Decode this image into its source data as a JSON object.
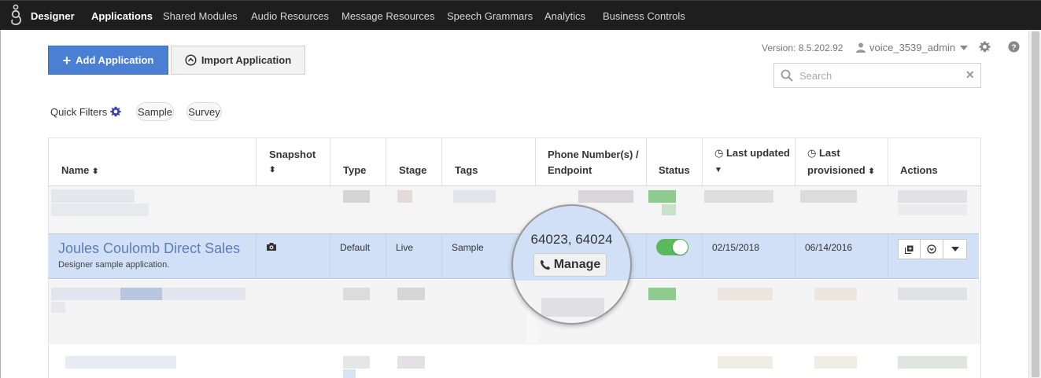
{
  "nav": {
    "brand": "Designer",
    "items": [
      {
        "label": "Applications",
        "active": true
      },
      {
        "label": "Shared Modules"
      },
      {
        "label": "Audio Resources"
      },
      {
        "label": "Message Resources"
      },
      {
        "label": "Speech Grammars"
      },
      {
        "label": "Analytics"
      },
      {
        "label": "Business Controls"
      }
    ]
  },
  "header": {
    "version": "Version: 8.5.202.92",
    "user": "voice_3539_admin",
    "search_placeholder": "Search"
  },
  "toolbar": {
    "add_label": "Add Application",
    "import_label": "Import Application"
  },
  "quick_filters": {
    "label": "Quick Filters",
    "chips": [
      "Sample",
      "Survey"
    ]
  },
  "table": {
    "columns": {
      "name": "Name",
      "snapshot": "Snapshot",
      "type": "Type",
      "stage": "Stage",
      "tags": "Tags",
      "phone_line1": "Phone Number(s) /",
      "phone_line2": "Endpoint",
      "status": "Status",
      "last_updated": "Last updated",
      "last_prov_line1": "Last",
      "last_prov_line2": "provisioned",
      "actions": "Actions"
    },
    "selected_row": {
      "name": "Joules Coulomb Direct Sales",
      "description": "Designer sample application.",
      "type": "Default",
      "stage": "Live",
      "tags": "Sample",
      "phone": "64023, 64024",
      "manage_label": "Manage",
      "status_on": true,
      "last_updated": "02/15/2018",
      "last_provisioned": "06/14/2016"
    }
  },
  "colors": {
    "nav_bg": "#1e1e1e",
    "primary": "#4a7fd4",
    "selected_row": "#d1e0f7",
    "toggle_on": "#5cb85c",
    "app_name": "#5b7db8"
  }
}
